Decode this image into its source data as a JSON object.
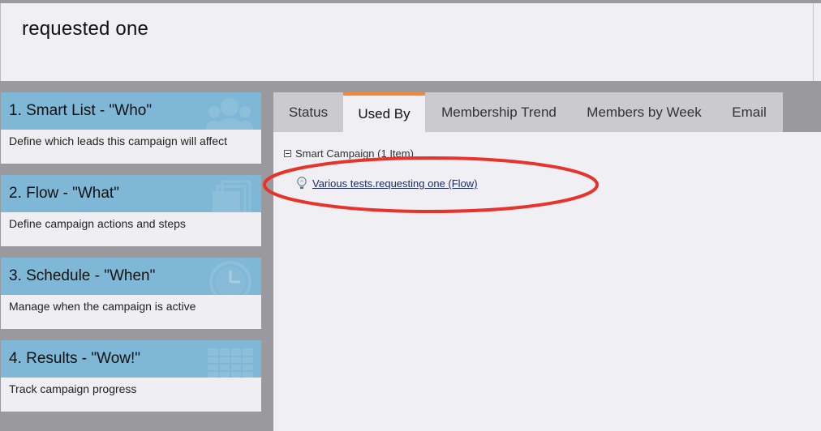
{
  "header": {
    "title": "requested one"
  },
  "steps": [
    {
      "title": "1. Smart List - \"Who\"",
      "desc": "Define which leads this campaign will affect",
      "icon": "people-icon"
    },
    {
      "title": "2. Flow - \"What\"",
      "desc": "Define campaign actions and steps",
      "icon": "stacked-pages-icon"
    },
    {
      "title": "3. Schedule - \"When\"",
      "desc": "Manage when the campaign is active",
      "icon": "clock-icon"
    },
    {
      "title": "4. Results - \"Wow!\"",
      "desc": "Track campaign progress",
      "icon": "table-grid-icon"
    }
  ],
  "tabs": [
    {
      "label": "Status",
      "active": false
    },
    {
      "label": "Used By",
      "active": true
    },
    {
      "label": "Membership Trend",
      "active": false
    },
    {
      "label": "Members by Week",
      "active": false
    },
    {
      "label": "Email",
      "active": false
    }
  ],
  "tree": {
    "group_label": "Smart Campaign (1 Item)",
    "items": [
      {
        "label": "Various tests.requesting one (Flow)",
        "icon": "lightbulb-icon"
      }
    ]
  },
  "colors": {
    "accent_tab": "#f08a3a",
    "step_header": "#7fb8d6",
    "highlight_ellipse": "#e8332a",
    "link": "#1d2a5e"
  }
}
